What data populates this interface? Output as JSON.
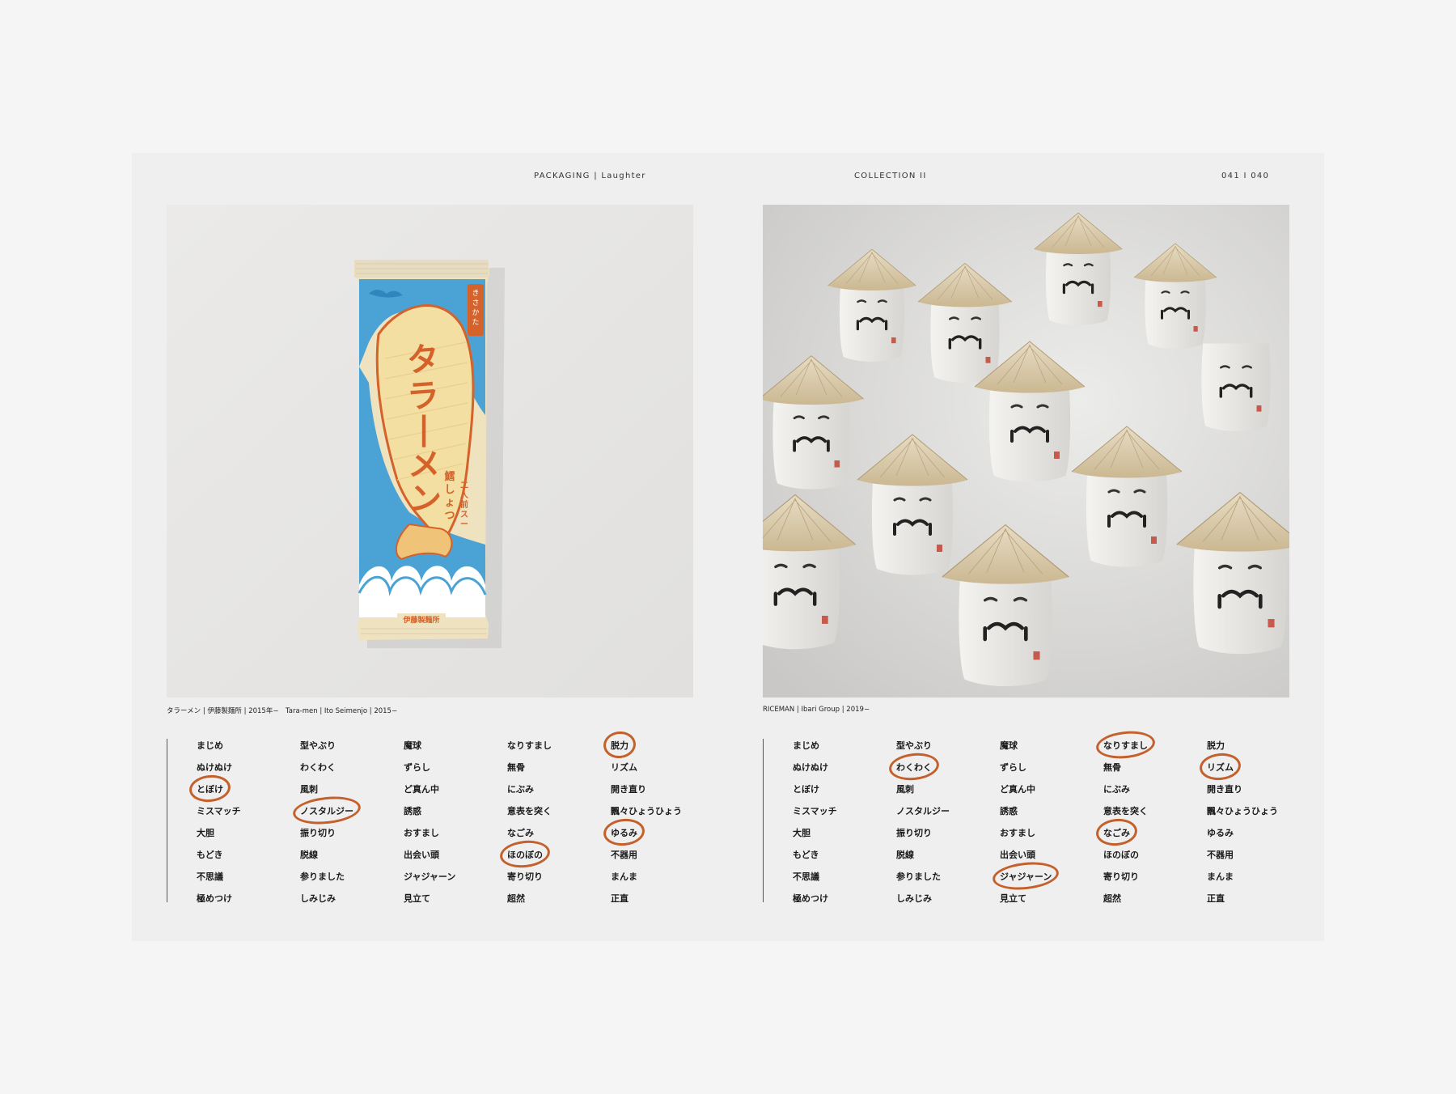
{
  "header": {
    "section": "PACKAGING",
    "subsection": "Laughter",
    "collection": "COLLECTION II",
    "page_numbers": "041 I 040"
  },
  "left": {
    "caption": "タラーメン | 伊藤製麺所 | 2015年−　Tara-men | Ito Seimenjo | 2015−",
    "product": {
      "brand_vertical": "きさかた名物",
      "title": "タラーメン",
      "flavor": "鱈しょっつる味",
      "servings": "二人前スープ付き",
      "maker": "伊藤製麺所"
    }
  },
  "right": {
    "caption": "RICEMAN | Ibari Group | 2019−"
  },
  "word_columns": [
    [
      "まじめ",
      "ぬけぬけ",
      "とぼけ",
      "ミスマッチ",
      "大胆",
      "もどき",
      "不思議",
      "極めつけ"
    ],
    [
      "型やぶり",
      "わくわく",
      "風刺",
      "ノスタルジー",
      "振り切り",
      "脱線",
      "参りました",
      "しみじみ"
    ],
    [
      "魔球",
      "ずらし",
      "ど真ん中",
      "誘惑",
      "おすまし",
      "出会い頭",
      "ジャジャーン",
      "見立て"
    ],
    [
      "なりすまし",
      "無骨",
      "にぶみ",
      "意表を突く",
      "なごみ",
      "ほのぼの",
      "寄り切り",
      "超然"
    ],
    [
      "脱力",
      "リズム",
      "開き直り",
      "飄々ひょうひょう",
      "ゆるみ",
      "不器用",
      "まんま",
      "正直"
    ]
  ],
  "circled_left": [
    "0-2",
    "1-3",
    "3-5",
    "4-0",
    "4-4"
  ],
  "circled_right": [
    "1-1",
    "2-6",
    "3-0",
    "3-4",
    "4-1"
  ],
  "colors": {
    "circle": "#c4602b",
    "pack_blue": "#4aa3d4",
    "pack_orange": "#d4622a",
    "pack_cream": "#efe3bf"
  }
}
